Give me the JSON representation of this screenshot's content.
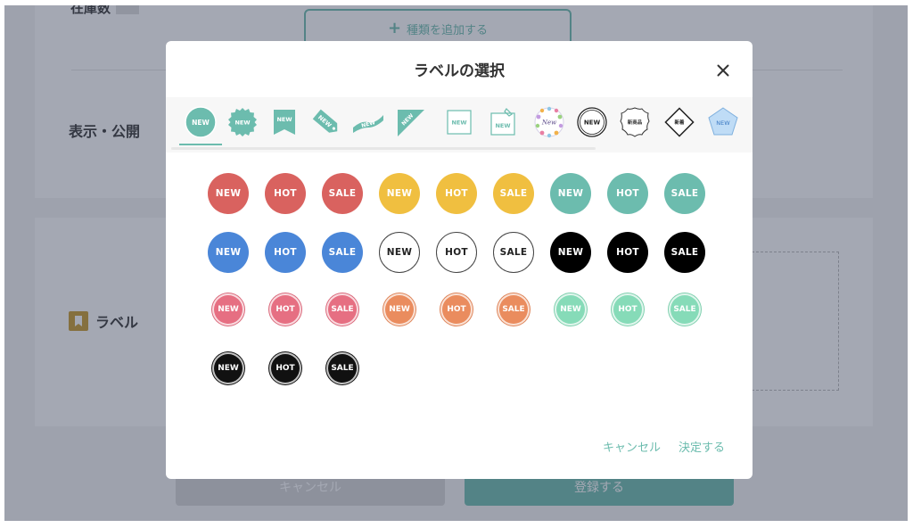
{
  "background": {
    "top_label": "在庫数",
    "add_type_button": "種類を追加する",
    "visibility_section_title": "表示・公開",
    "label_section_title": "ラベル",
    "cancel_button": "キャンセル",
    "register_button": "登録する"
  },
  "modal": {
    "title": "ラベルの選択",
    "close_icon": "close-icon",
    "tabs": [
      {
        "name": "circle",
        "text": "NEW"
      },
      {
        "name": "seal",
        "text": "NEW"
      },
      {
        "name": "ribbon",
        "text": "NEW"
      },
      {
        "name": "tag",
        "text": "NEW"
      },
      {
        "name": "wave",
        "text": "NEW"
      },
      {
        "name": "corner",
        "text": "NEW"
      },
      {
        "name": "square",
        "text": "NEW"
      },
      {
        "name": "clip",
        "text": "NEW"
      },
      {
        "name": "floral",
        "text": "New"
      },
      {
        "name": "ring",
        "text": "NEW"
      },
      {
        "name": "stamp",
        "text": "新商品"
      },
      {
        "name": "diamond",
        "text": "新着"
      },
      {
        "name": "pentagon",
        "text": "NEW"
      }
    ],
    "badges_large": [
      {
        "text": "NEW",
        "color": "#d9625f"
      },
      {
        "text": "HOT",
        "color": "#d9625f"
      },
      {
        "text": "SALE",
        "color": "#d9625f"
      },
      {
        "text": "NEW",
        "color": "#f0bf40"
      },
      {
        "text": "HOT",
        "color": "#f0bf40"
      },
      {
        "text": "SALE",
        "color": "#f0bf40"
      },
      {
        "text": "NEW",
        "color": "#6cbcae"
      },
      {
        "text": "HOT",
        "color": "#6cbcae"
      },
      {
        "text": "SALE",
        "color": "#6cbcae"
      },
      {
        "text": "NEW",
        "color": "#4a86d8"
      },
      {
        "text": "HOT",
        "color": "#4a86d8"
      },
      {
        "text": "SALE",
        "color": "#4a86d8"
      },
      {
        "text": "NEW",
        "color": "#ffffff",
        "outline": true
      },
      {
        "text": "HOT",
        "color": "#ffffff",
        "outline": true
      },
      {
        "text": "SALE",
        "color": "#ffffff",
        "outline": true
      },
      {
        "text": "NEW",
        "color": "#000000"
      },
      {
        "text": "HOT",
        "color": "#000000"
      },
      {
        "text": "SALE",
        "color": "#000000"
      }
    ],
    "badges_small": [
      {
        "text": "NEW",
        "color": "#e66f82"
      },
      {
        "text": "HOT",
        "color": "#e66f82"
      },
      {
        "text": "SALE",
        "color": "#e66f82"
      },
      {
        "text": "NEW",
        "color": "#ea8c5e"
      },
      {
        "text": "HOT",
        "color": "#ea8c5e"
      },
      {
        "text": "SALE",
        "color": "#ea8c5e"
      },
      {
        "text": "NEW",
        "color": "#86dbb8"
      },
      {
        "text": "HOT",
        "color": "#86dbb8"
      },
      {
        "text": "SALE",
        "color": "#86dbb8"
      },
      {
        "text": "NEW",
        "color": "#111111"
      },
      {
        "text": "HOT",
        "color": "#111111"
      },
      {
        "text": "SALE",
        "color": "#111111"
      }
    ],
    "cancel_button": "キャンセル",
    "confirm_button": "決定する"
  },
  "colors": {
    "accent": "#6cbcae",
    "overlay": "#363e56"
  }
}
